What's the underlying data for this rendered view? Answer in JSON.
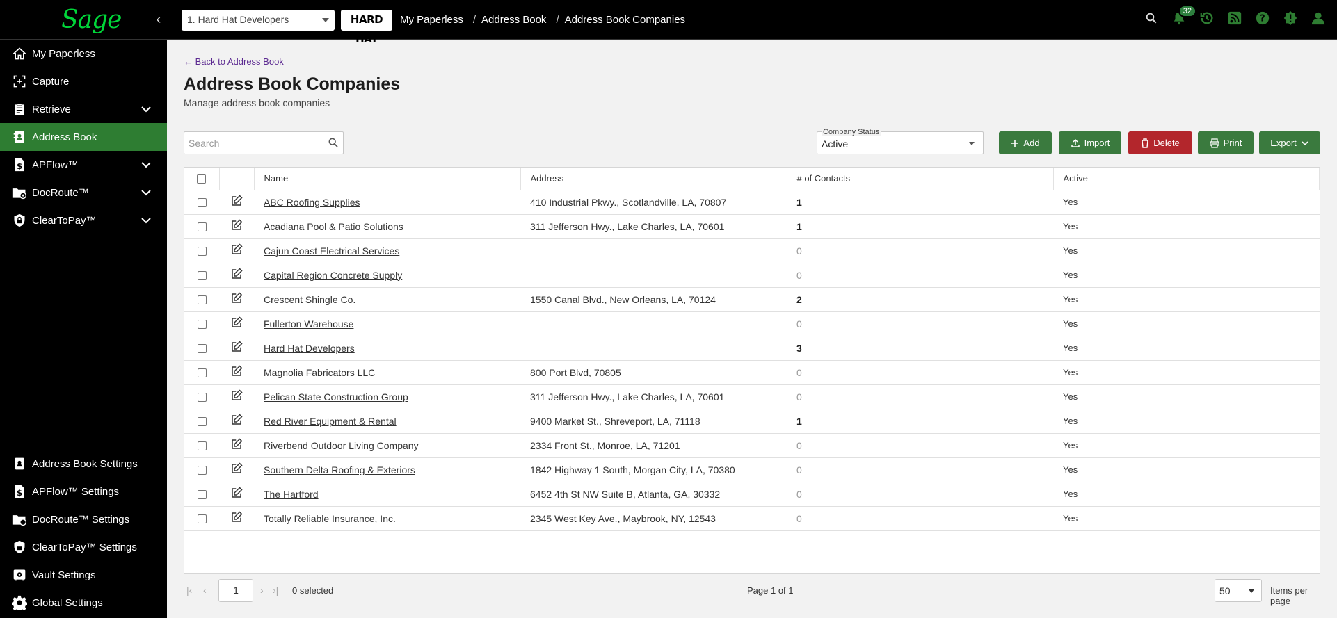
{
  "header": {
    "logo_text": "Sage",
    "company_select": "1. Hard Hat Developers",
    "brand_logo": "HARD HAT",
    "breadcrumbs": [
      "My Paperless",
      "Address Book",
      "Address Book Companies"
    ],
    "notification_count": "32",
    "icons": [
      "search-icon",
      "bell-icon",
      "history-icon",
      "rss-icon",
      "help-icon",
      "alert-icon",
      "user-icon"
    ]
  },
  "sidebar": {
    "items": [
      {
        "label": "My Paperless",
        "icon": "home-icon"
      },
      {
        "label": "Capture",
        "icon": "capture-icon"
      },
      {
        "label": "Retrieve",
        "icon": "clipboard-icon"
      },
      {
        "label": "Address Book",
        "icon": "contacts-book-icon"
      },
      {
        "label": "APFlow™",
        "icon": "dollar-doc-icon"
      },
      {
        "label": "DocRoute™",
        "icon": "folder-route-icon"
      },
      {
        "label": "ClearToPay™",
        "icon": "shield-lock-icon"
      }
    ],
    "settings": [
      {
        "label": "Address Book Settings",
        "icon": "contacts-book-icon"
      },
      {
        "label": "APFlow™ Settings",
        "icon": "dollar-doc-icon"
      },
      {
        "label": "DocRoute™ Settings",
        "icon": "folder-route-icon"
      },
      {
        "label": "ClearToPay™ Settings",
        "icon": "shield-lock-icon"
      },
      {
        "label": "Vault Settings",
        "icon": "vault-icon"
      },
      {
        "label": "Global Settings",
        "icon": "gear-icon"
      }
    ],
    "active": "Address Book"
  },
  "main": {
    "back_link": "← Back to Address Book",
    "title": "Address Book Companies",
    "subtitle": "Manage address book companies",
    "search_placeholder": "Search",
    "status_label": "Company Status",
    "status_value": "Active",
    "buttons": {
      "add": "Add",
      "import": "Import",
      "delete": "Delete",
      "print": "Print",
      "export": "Export"
    },
    "colors": {
      "green": "#3a7a3e",
      "red": "#b3262c",
      "active_nav": "#2e7d32",
      "logo": "#00d639"
    }
  },
  "table": {
    "columns": [
      "Name",
      "Address",
      "# of Contacts",
      "Active"
    ],
    "rows": [
      {
        "name": "ABC Roofing Supplies",
        "address": "410 Industrial Pkwy., Scotlandville, LA, 70807",
        "contacts": "1",
        "active": "Yes"
      },
      {
        "name": "Acadiana Pool & Patio Solutions",
        "address": "311 Jefferson Hwy., Lake Charles, LA, 70601",
        "contacts": "1",
        "active": "Yes"
      },
      {
        "name": "Cajun Coast Electrical Services",
        "address": "",
        "contacts": "0",
        "active": "Yes"
      },
      {
        "name": "Capital Region Concrete Supply",
        "address": "",
        "contacts": "0",
        "active": "Yes"
      },
      {
        "name": "Crescent Shingle Co.",
        "address": "1550 Canal Blvd., New Orleans, LA, 70124",
        "contacts": "2",
        "active": "Yes"
      },
      {
        "name": "Fullerton Warehouse",
        "address": "",
        "contacts": "0",
        "active": "Yes"
      },
      {
        "name": "Hard Hat Developers",
        "address": "",
        "contacts": "3",
        "active": "Yes"
      },
      {
        "name": "Magnolia Fabricators LLC",
        "address": "800 Port Blvd, 70805",
        "contacts": "0",
        "active": "Yes"
      },
      {
        "name": "Pelican State Construction Group",
        "address": "311 Jefferson Hwy., Lake Charles, LA, 70601",
        "contacts": "0",
        "active": "Yes"
      },
      {
        "name": "Red River Equipment & Rental",
        "address": "9400 Market St., Shreveport, LA, 71118",
        "contacts": "1",
        "active": "Yes"
      },
      {
        "name": "Riverbend Outdoor Living Company",
        "address": "2334 Front St., Monroe, LA, 71201",
        "contacts": "0",
        "active": "Yes"
      },
      {
        "name": "Southern Delta Roofing & Exteriors",
        "address": "1842 Highway 1 South, Morgan City, LA, 70380",
        "contacts": "0",
        "active": "Yes"
      },
      {
        "name": "The Hartford",
        "address": "6452 4th St NW Suite B, Atlanta, GA, 30332",
        "contacts": "0",
        "active": "Yes"
      },
      {
        "name": "Totally Reliable Insurance, Inc.",
        "address": "2345 West Key Ave., Maybrook, NY, 12543",
        "contacts": "0",
        "active": "Yes"
      }
    ]
  },
  "pager": {
    "page": "1",
    "selected": "0 selected",
    "info": "Page 1 of 1",
    "page_size": "50",
    "per_page_label": "Items per page"
  }
}
